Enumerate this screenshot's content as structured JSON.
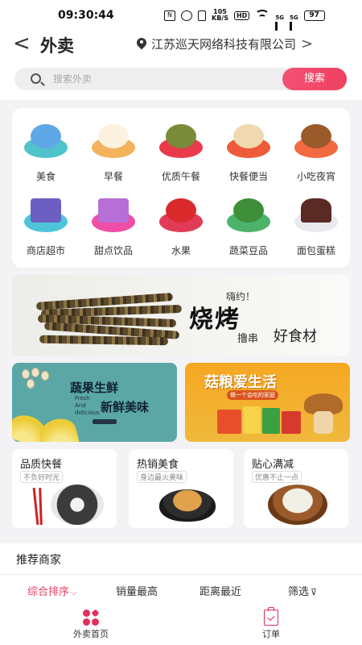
{
  "status_bar": {
    "time": "09:30:44",
    "nfc": "N",
    "net_speed_top": "105",
    "net_speed_bottom": "KB/S",
    "hd": "HD",
    "sig1": "5G",
    "sig2": "5G",
    "battery": "97"
  },
  "header": {
    "back": "<",
    "title": "外卖",
    "location": "江苏巡天网络科技有限公司",
    "location_arrow": ">"
  },
  "search": {
    "placeholder": "搜索外卖",
    "button": "搜索"
  },
  "categories": [
    {
      "label": "美食",
      "icon": "food-icon",
      "bg": "#4fc3c9",
      "fg": "#5fa7e6"
    },
    {
      "label": "早餐",
      "icon": "breakfast-icon",
      "bg": "#f5b25d",
      "fg": "#fdf1e0"
    },
    {
      "label": "优质午餐",
      "icon": "lunch-icon",
      "bg": "#ea3b4b",
      "fg": "#7a8b3a"
    },
    {
      "label": "快餐便当",
      "icon": "bento-icon",
      "bg": "#ee5b3a",
      "fg": "#f0d9b0"
    },
    {
      "label": "小吃夜宵",
      "icon": "snack-icon",
      "bg": "#f26a3f",
      "fg": "#9a5a2a"
    },
    {
      "label": "商店超市",
      "icon": "supermarket-icon",
      "bg": "#4ec4da",
      "fg": "#6d5fc2"
    },
    {
      "label": "甜点饮品",
      "icon": "dessert-icon",
      "bg": "#ef4fa7",
      "fg": "#b56fd6"
    },
    {
      "label": "水果",
      "icon": "fruit-icon",
      "bg": "#e23b57",
      "fg": "#d92b2b"
    },
    {
      "label": "蔬菜豆品",
      "icon": "vegetable-icon",
      "bg": "#4bb36a",
      "fg": "#3f8f3a"
    },
    {
      "label": "面包蛋糕",
      "icon": "cake-icon",
      "bg": "#e9e9ee",
      "fg": "#5a2a24"
    }
  ],
  "banner": {
    "small": "嗨约！",
    "big": "烧烤",
    "sub1": "撸串",
    "sub2": "好食材"
  },
  "promos": [
    {
      "title_a": "蔬果生鲜",
      "eng": "Fresh And delicious",
      "title_b": "新鲜美味"
    },
    {
      "title": "菇粮爱生活",
      "tag": "做一个会吃的家庭"
    }
  ],
  "features": [
    {
      "title": "品质快餐",
      "sub": "不负好时光"
    },
    {
      "title": "热销美食",
      "sub": "身边最火美味"
    },
    {
      "title": "贴心满减",
      "sub": "优惠不止一点"
    }
  ],
  "recommend": {
    "title": "推荐商家"
  },
  "sort": {
    "items": [
      "综合排序",
      "销量最高",
      "距离最近",
      "筛选"
    ],
    "active_color": "#e83e62"
  },
  "nav": {
    "home": "外卖首页",
    "orders": "订单"
  }
}
